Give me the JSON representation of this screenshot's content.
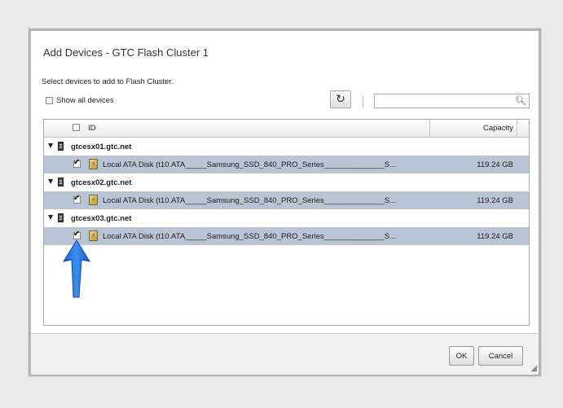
{
  "dialog": {
    "title": "Add Devices - GTC Flash Cluster 1",
    "instruction": "Select devices to add to Flash Cluster.",
    "show_all_label": "Show all devices",
    "search": {
      "value": "",
      "placeholder": ""
    }
  },
  "grid": {
    "headers": {
      "id": "ID",
      "capacity": "Capacity"
    },
    "groups": [
      {
        "host": "gtcesx01.gtc.net",
        "devices": [
          {
            "name": "Local ATA Disk (t10.ATA_____Samsung_SSD_840_PRO_Series______________S...",
            "capacity": "119.24 GB",
            "checked": true
          }
        ]
      },
      {
        "host": "gtcesx02.gtc.net",
        "devices": [
          {
            "name": "Local ATA Disk (t10.ATA_____Samsung_SSD_840_PRO_Series______________S...",
            "capacity": "119.24 GB",
            "checked": true
          }
        ]
      },
      {
        "host": "gtcesx03.gtc.net",
        "devices": [
          {
            "name": "Local ATA Disk (t10.ATA_____Samsung_SSD_840_PRO_Series______________S...",
            "capacity": "119.24 GB",
            "checked": true
          }
        ]
      }
    ]
  },
  "buttons": {
    "ok": "OK",
    "cancel": "Cancel"
  },
  "icons": {
    "refresh": "refresh-icon",
    "search": "search-icon",
    "host": "host-server-icon",
    "disk": "disk-icon",
    "expand": "expand-arrow-icon",
    "annotation": "blue-arrow-annotation"
  },
  "colors": {
    "selected_row": "#b9c4d4",
    "annotation_arrow": "#1f6fd6"
  }
}
